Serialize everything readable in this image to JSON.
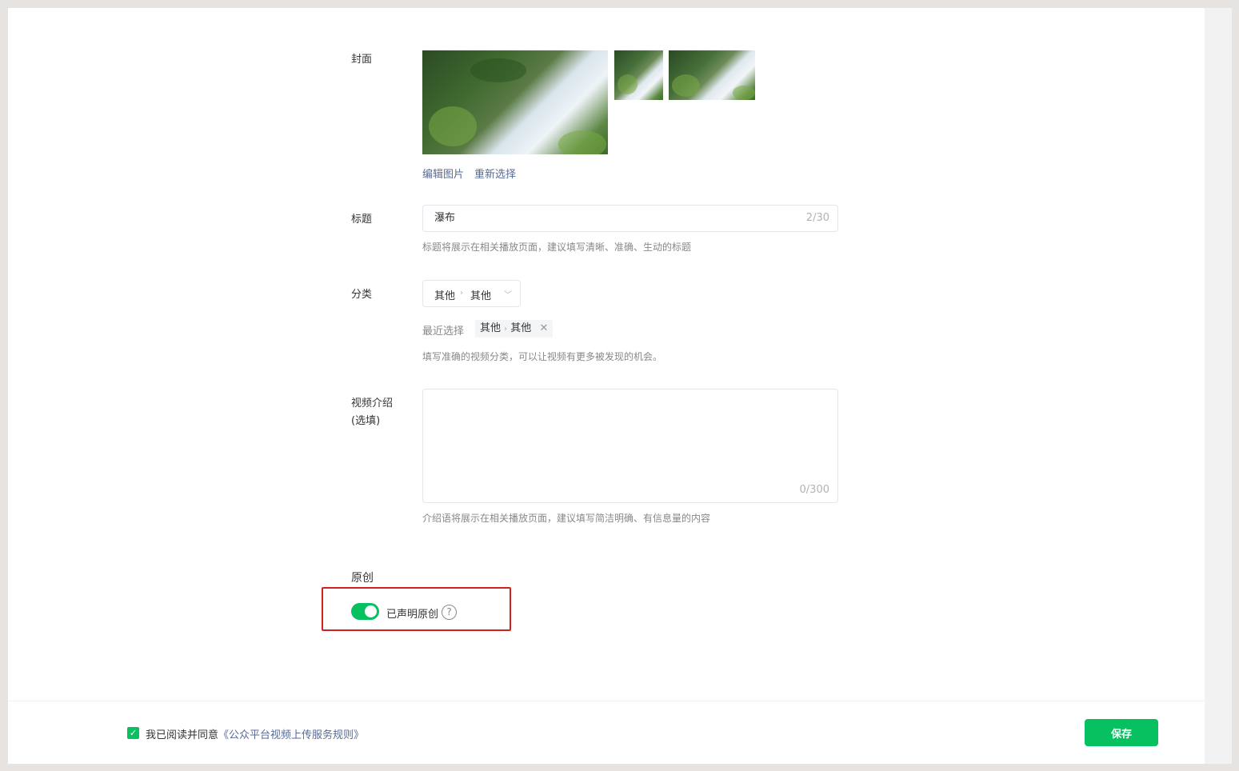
{
  "cover": {
    "label": "封面",
    "edit_link": "编辑图片",
    "reselect_link": "重新选择"
  },
  "title": {
    "label": "标题",
    "value": "瀑布",
    "counter": "2/30",
    "hint": "标题将展示在相关播放页面，建议填写清晰、准确、生动的标题"
  },
  "category": {
    "label": "分类",
    "selected_primary": "其他",
    "selected_secondary": "其他",
    "recent_label": "最近选择",
    "recent_primary": "其他",
    "recent_secondary": "其他",
    "hint": "填写准确的视频分类，可以让视频有更多被发现的机会。"
  },
  "description": {
    "label_line1": "视频介绍",
    "label_line2": "(选填)",
    "value": "",
    "counter": "0/300",
    "hint": "介绍语将展示在相关播放页面，建议填写简洁明确、有信息量的内容"
  },
  "original": {
    "section_title": "原创",
    "toggle_label": "已声明原创",
    "enabled": true,
    "help_glyph": "?"
  },
  "footer": {
    "agree_prefix": "我已阅读并同意",
    "agree_link": "《公众平台视频上传服务规则》",
    "save_button": "保存"
  },
  "colors": {
    "accent": "#07c160",
    "link": "#576b95",
    "highlight_box": "#d32020"
  },
  "icons": {
    "chevron": "chevron-down-icon",
    "remove": "close-icon",
    "help": "help-circle-icon",
    "check": "checkmark-icon"
  }
}
